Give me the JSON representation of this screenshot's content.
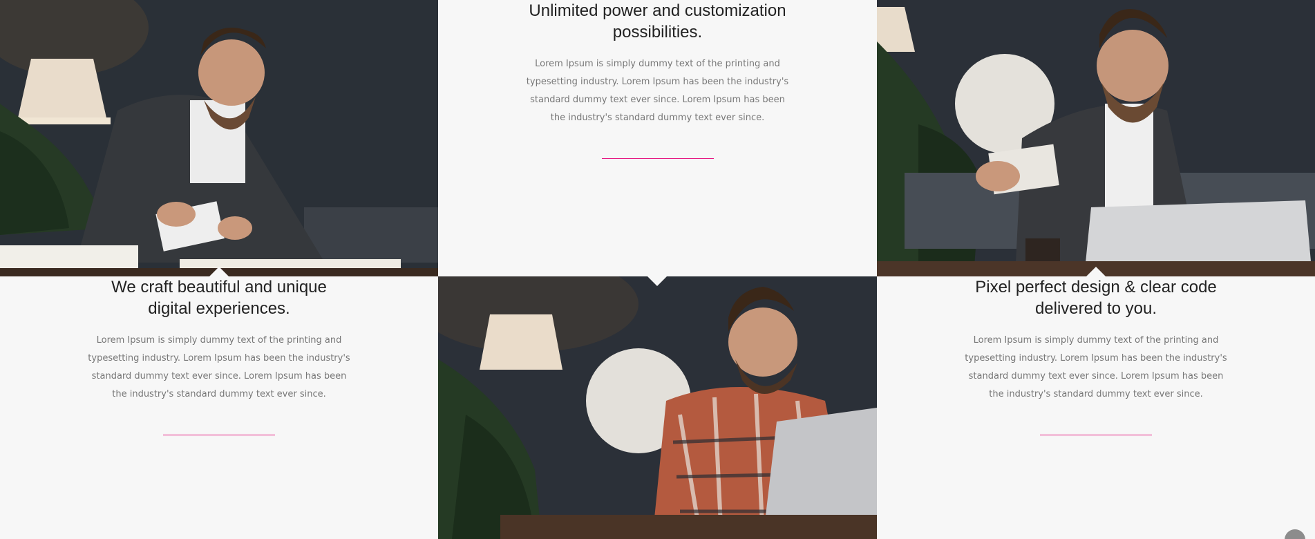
{
  "features": [
    {
      "title": "Unlimited power and customization possibilities.",
      "body": "Lorem Ipsum is simply dummy text of the printing and typesetting industry. Lorem Ipsum has been the industry's standard dummy text ever since. Lorem Ipsum has been the industry's standard dummy text ever since."
    },
    {
      "title": "We craft beautiful and unique digital experiences.",
      "body": "Lorem Ipsum is simply dummy text of the printing and typesetting industry. Lorem Ipsum has been the industry's standard dummy text ever since. Lorem Ipsum has been the industry's standard dummy text ever since."
    },
    {
      "title": "Pixel perfect design & clear code delivered to you.",
      "body": "Lorem Ipsum is simply dummy text of the printing and typesetting industry. Lorem Ipsum has been the industry's standard dummy text ever since. Lorem Ipsum has been the industry's standard dummy text ever since."
    }
  ],
  "colors": {
    "accent": "#e5127d",
    "background": "#f7f7f7",
    "heading": "#222222",
    "body_text": "#777777"
  },
  "icons": {
    "scroll_top": "arrow-up-icon"
  }
}
